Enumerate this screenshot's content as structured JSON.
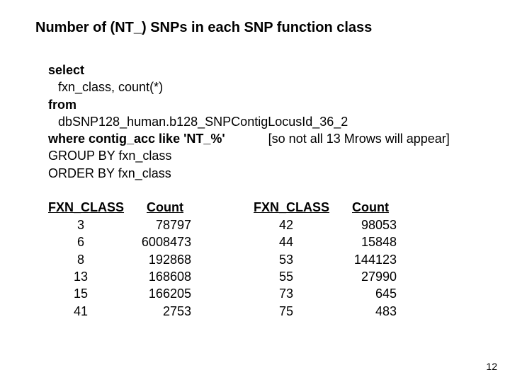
{
  "title": "Number of (NT_) SNPs in each SNP function class",
  "sql": {
    "l1": "select",
    "l2": "fxn_class, count(*)",
    "l3": "from",
    "l4": "dbSNP128_human.b128_SNPContigLocusId_36_2",
    "l5a": "where contig_acc like 'NT_%'",
    "l5b": "[so not all 13 Mrows will appear]",
    "l6": "GROUP BY fxn_class",
    "l7": "ORDER BY fxn_class"
  },
  "headers": {
    "fxn": "FXN_CLASS",
    "count": "Count"
  },
  "left": {
    "fxn": [
      "3",
      "6",
      "8",
      "13",
      "15",
      "41"
    ],
    "count": [
      "78797",
      "6008473",
      "192868",
      "168608",
      "166205",
      "2753"
    ]
  },
  "right": {
    "fxn": [
      "42",
      "44",
      "53",
      "55",
      "73",
      "75"
    ],
    "count": [
      "98053",
      "15848",
      "144123",
      "27990",
      "645",
      "483"
    ]
  },
  "page": "12",
  "chart_data": {
    "type": "table",
    "title": "Number of (NT_) SNPs in each SNP function class",
    "columns": [
      "FXN_CLASS",
      "Count"
    ],
    "rows": [
      [
        3,
        78797
      ],
      [
        6,
        6008473
      ],
      [
        8,
        192868
      ],
      [
        13,
        168608
      ],
      [
        15,
        166205
      ],
      [
        41,
        2753
      ],
      [
        42,
        98053
      ],
      [
        44,
        15848
      ],
      [
        53,
        144123
      ],
      [
        55,
        27990
      ],
      [
        73,
        645
      ],
      [
        75,
        483
      ]
    ]
  }
}
